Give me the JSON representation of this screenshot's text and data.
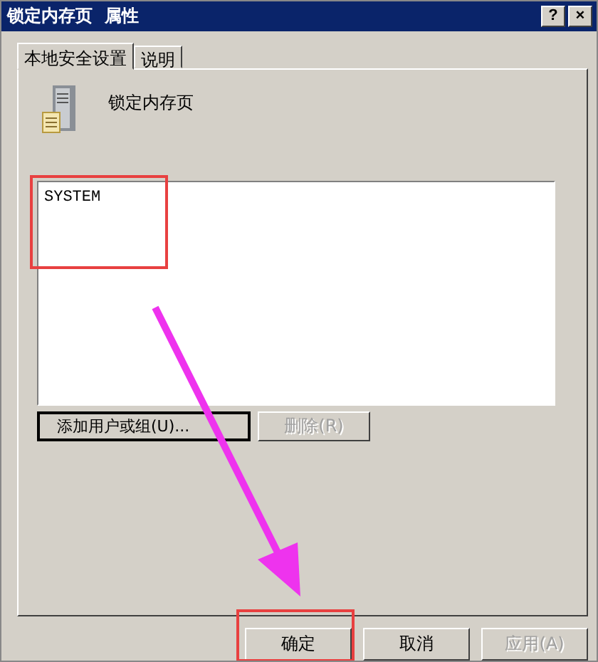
{
  "window": {
    "title": "锁定内存页  属性",
    "help_button": "?",
    "close_button": "×"
  },
  "tabs": [
    {
      "label": "本地安全设置",
      "selected": true
    },
    {
      "label": "说明",
      "selected": false
    }
  ],
  "policy_name": "锁定内存页",
  "users": [
    {
      "name": "SYSTEM",
      "selected": false
    }
  ],
  "list_buttons": [
    {
      "label": "添加用户或组(U)...",
      "disabled": false
    },
    {
      "label": "删除(R)",
      "disabled": true
    }
  ],
  "buttons": [
    {
      "label": "确定",
      "disabled": false
    },
    {
      "label": "取消",
      "disabled": false
    },
    {
      "label": "应用(A)",
      "disabled": true
    }
  ]
}
